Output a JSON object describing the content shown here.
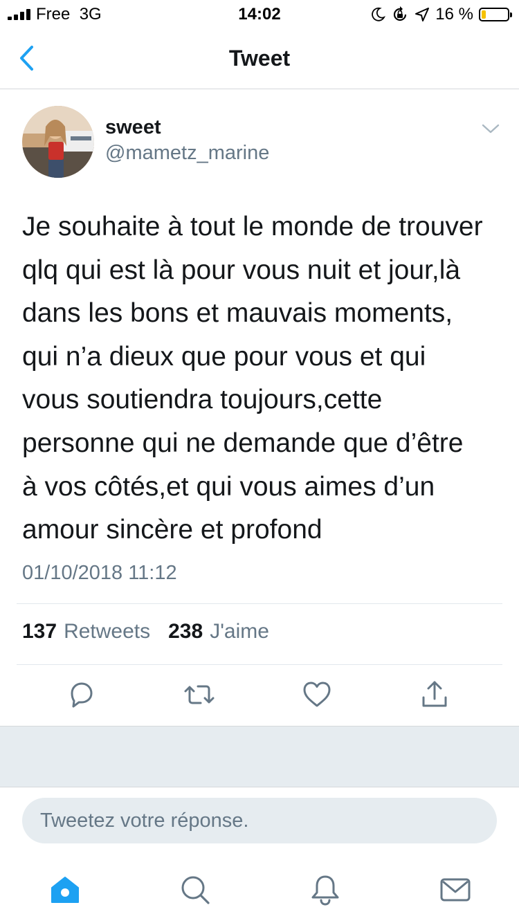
{
  "status_bar": {
    "carrier": "Free",
    "network": "3G",
    "time": "14:02",
    "battery_percent": "16 %",
    "battery_level": 0.16,
    "icons": [
      "signal-icon",
      "moon-icon",
      "rotation-lock-icon",
      "location-icon",
      "battery-icon"
    ]
  },
  "nav": {
    "title": "Tweet",
    "back_icon": "chevron-left-icon"
  },
  "tweet": {
    "author_name": "sweet",
    "author_handle": "@mametz_marine",
    "text": "Je souhaite à tout le monde de trouver\nqlq qui est là pour vous nuit et jour,là\ndans les bons et mauvais moments,\nqui n’a dieux que pour vous et qui\nvous soutiendra toujours,cette\npersonne qui ne demande que d’être\nà vos côtés,et qui vous aimes d’un\namour sincère et profond",
    "timestamp": "01/10/2018 11:12",
    "retweets_count": "137",
    "retweets_label": "Retweets",
    "likes_count": "238",
    "likes_label": "J'aime"
  },
  "actions": [
    "reply-icon",
    "retweet-icon",
    "like-icon",
    "share-icon"
  ],
  "reply_box": {
    "placeholder": "Tweetez votre réponse."
  },
  "tab_bar": [
    "home-icon",
    "search-icon",
    "notifications-icon",
    "messages-icon"
  ],
  "colors": {
    "accent": "#1da1f2",
    "secondary_text": "#657786",
    "icon_gray": "#657786",
    "battery": "#f6c200"
  }
}
